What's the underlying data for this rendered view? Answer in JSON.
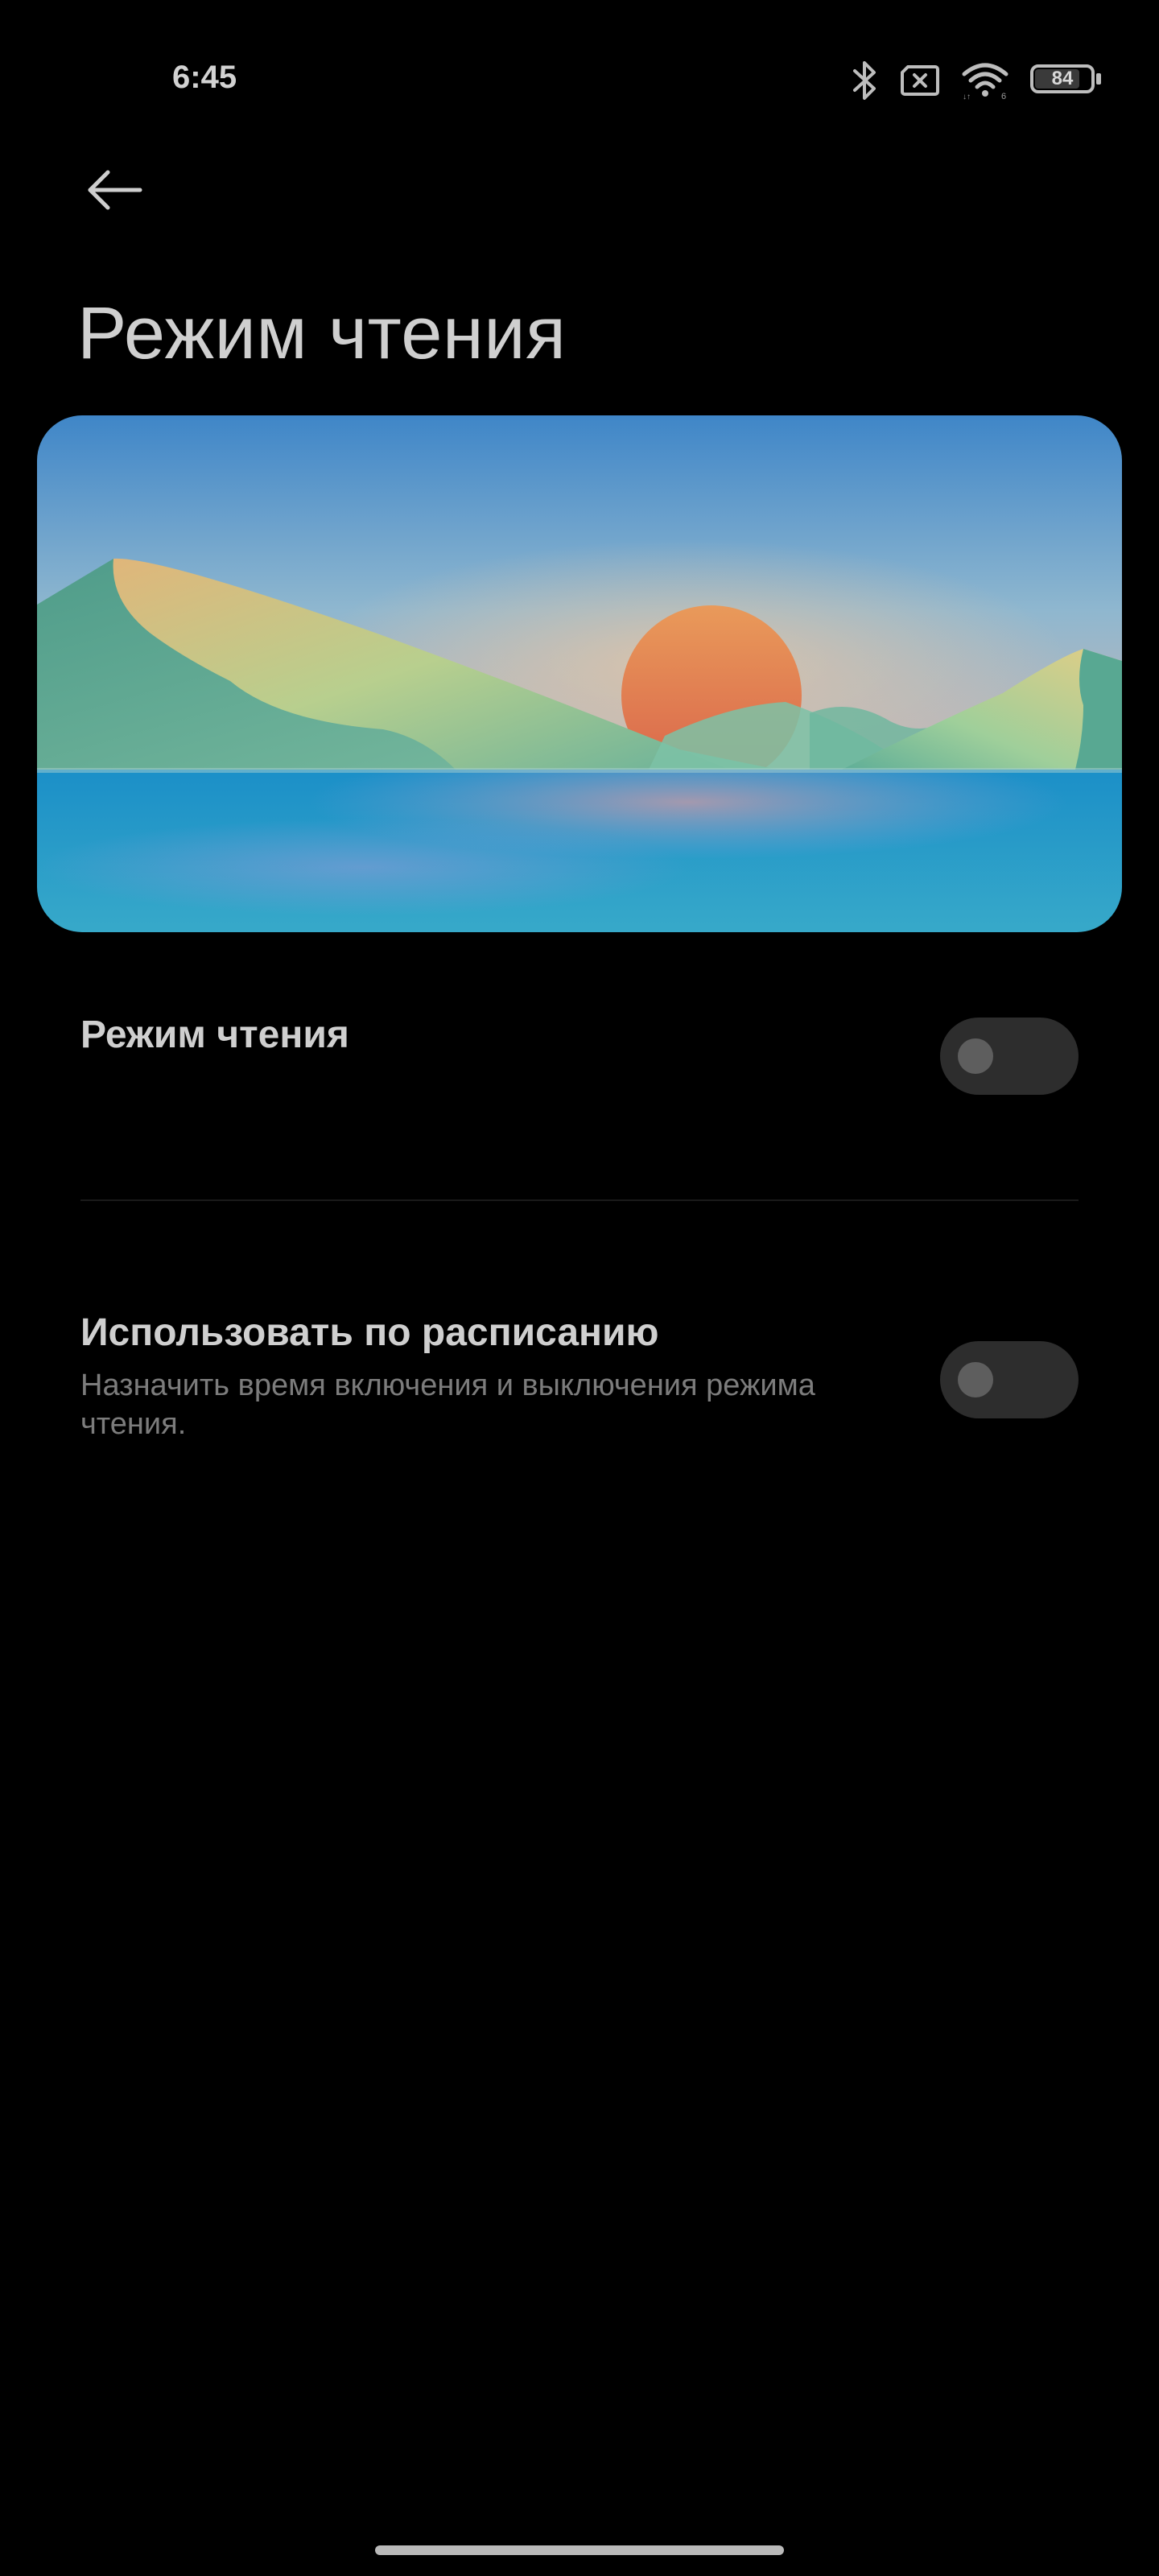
{
  "status_bar": {
    "time": "6:45",
    "battery": "84",
    "icons": [
      "bluetooth-icon",
      "sim-no-signal-icon",
      "wifi-icon",
      "battery-icon"
    ]
  },
  "header": {
    "back_icon": "arrow-left-icon",
    "title": "Режим чтения"
  },
  "hero": {
    "illustration": "landscape-sunset"
  },
  "settings": [
    {
      "title": "Режим чтения",
      "enabled": false
    },
    {
      "title": "Использовать по расписанию",
      "subtitle": "Назначить время включения и выключения режима чтения.",
      "enabled": false
    }
  ],
  "colors": {
    "background": "#000000",
    "text": "#cfcfcf",
    "subtext": "#7c7c7c",
    "toggle_track": "#2d2d2d",
    "toggle_knob": "#5e5e5e"
  }
}
